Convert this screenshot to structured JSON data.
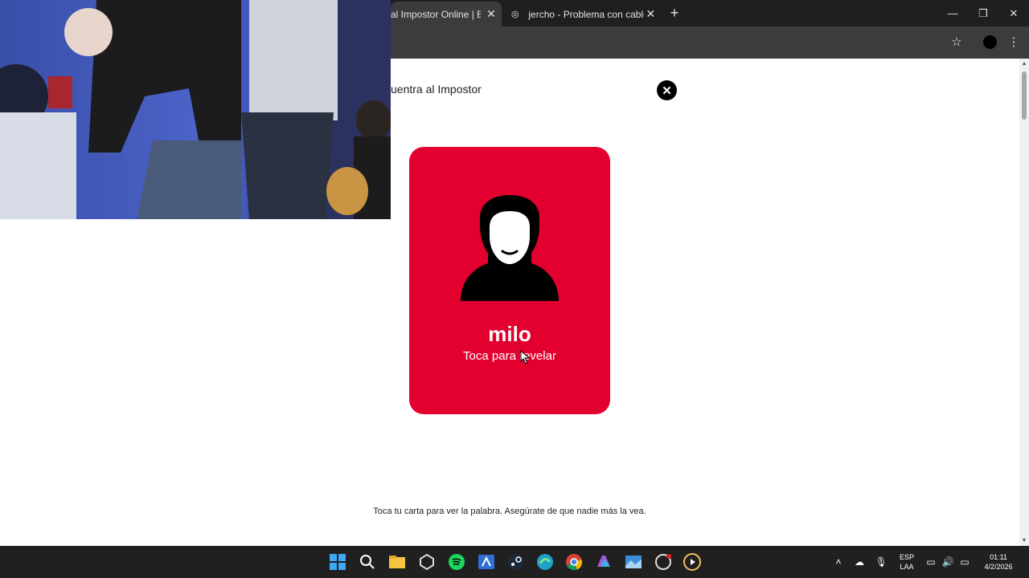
{
  "browser": {
    "tabs": [
      {
        "label": "al Impostor Online | Encu",
        "active": true
      },
      {
        "label": "jercho - Problema con cable",
        "active": false
      }
    ]
  },
  "page": {
    "title": "uentra al Impostor",
    "card": {
      "name": "milo",
      "hint": "Toca para revelar",
      "color": "#e3002f"
    },
    "footer_hint": "Toca tu carta para ver la palabra. Asegúrate de que nadie más la vea."
  },
  "taskbar": {
    "apps": [
      "windows-start",
      "search",
      "file-explorer",
      "unity",
      "spotify",
      "vs-code-like",
      "steam",
      "edge",
      "chrome",
      "copilot",
      "photos",
      "obs",
      "media-player"
    ],
    "language_top": "ESP",
    "language_bottom": "LAA",
    "time": "01:11",
    "date": "4/2/2026"
  }
}
